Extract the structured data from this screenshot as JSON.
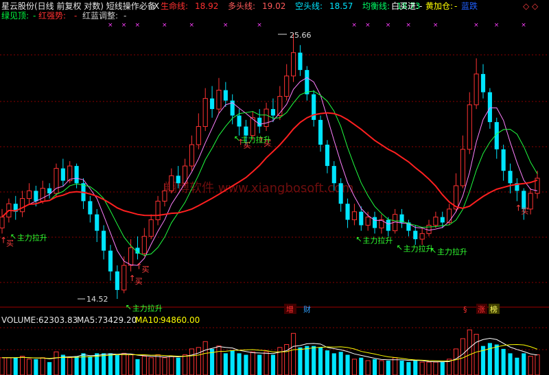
{
  "header": {
    "title": "星云股份(日线 前复权 对数) 短线操作必备",
    "close_symbol": "X",
    "indicators": [
      {
        "label": "生命线:",
        "value": "18.92",
        "color": "#ff3030"
      },
      {
        "label": "多头线:",
        "value": "19.02",
        "color": "#ff5a5a"
      },
      {
        "label": "空头线:",
        "value": "18.57",
        "color": "#00e5ff"
      },
      {
        "label": "均衡线:",
        "value": "18.73",
        "color": "#00ff66"
      }
    ],
    "buy_label": "白买进:",
    "buy_value": "-",
    "add_label": "黄加仓:",
    "add_value": "-",
    "extra_label": "蓝跌",
    "right_marker": "◇ ◇"
  },
  "subheader": {
    "green_label": "绿见顶:",
    "green_value": "-",
    "red_label": "红强势:",
    "red_value": "-",
    "adjust_label": "红蓝调整:",
    "adjust_value": "-"
  },
  "watermark": "翔博软件 www.xiangbosoft.com",
  "price_annotations": {
    "high": "25.66",
    "low": "14.52"
  },
  "signals": {
    "buy": "买",
    "pull": "主力拉升",
    "up_arrow": "↑",
    "diag_arrow": "↖"
  },
  "badges": [
    "增",
    "财",
    "§",
    "涨",
    "榜"
  ],
  "volume_header": {
    "volume_label": "VOLUME:",
    "volume_value": "62303.83",
    "ma5_label": "MA5:",
    "ma5_value": "73429.20",
    "ma10_label": "MA10:",
    "ma10_value": "94860.00"
  },
  "colors": {
    "up": "#ff3232",
    "down": "#00e5ff",
    "lifeline": "#ff2020",
    "ma_green": "#20ff40",
    "ma_pink": "#ff80ff",
    "buy_signal": "#ff4040",
    "pull_signal": "#30ff30"
  },
  "chart_data": {
    "type": "candlestick",
    "title": "星云股份(日线 前复权 对数)",
    "scale": "log",
    "ylim": [
      14.52,
      25.66
    ],
    "grid": true,
    "candles": [
      [
        16.9,
        17.3,
        17.6,
        16.7
      ],
      [
        17.3,
        17.8,
        18.0,
        17.1
      ],
      [
        17.8,
        17.5,
        18.1,
        17.2
      ],
      [
        17.5,
        18.0,
        18.3,
        17.3
      ],
      [
        18.0,
        18.3,
        18.6,
        17.8
      ],
      [
        18.3,
        17.9,
        18.5,
        17.7
      ],
      [
        17.9,
        18.4,
        18.7,
        17.8
      ],
      [
        18.4,
        18.2,
        18.6,
        18.0
      ],
      [
        18.2,
        19.2,
        19.4,
        18.1
      ],
      [
        19.2,
        18.7,
        19.6,
        18.5
      ],
      [
        18.7,
        19.3,
        19.5,
        18.6
      ],
      [
        19.3,
        18.6,
        19.4,
        18.4
      ],
      [
        18.6,
        17.9,
        18.8,
        17.6
      ],
      [
        17.9,
        17.4,
        18.1,
        17.1
      ],
      [
        17.4,
        16.8,
        17.6,
        16.4
      ],
      [
        16.8,
        16.1,
        17.0,
        15.8
      ],
      [
        16.1,
        15.4,
        16.3,
        15.1
      ],
      [
        15.4,
        14.8,
        15.6,
        14.52
      ],
      [
        14.8,
        15.6,
        15.9,
        14.7
      ],
      [
        15.6,
        16.2,
        16.5,
        15.4
      ],
      [
        16.2,
        16.0,
        16.6,
        15.8
      ],
      [
        16.0,
        16.6,
        16.9,
        15.9
      ],
      [
        16.6,
        17.2,
        17.4,
        16.5
      ],
      [
        17.2,
        17.9,
        18.1,
        17.0
      ],
      [
        17.9,
        18.3,
        18.6,
        17.7
      ],
      [
        18.3,
        18.9,
        19.2,
        18.2
      ],
      [
        18.9,
        18.6,
        19.3,
        18.4
      ],
      [
        18.6,
        19.3,
        19.6,
        18.5
      ],
      [
        19.3,
        20.2,
        20.6,
        19.1
      ],
      [
        20.2,
        21.0,
        21.6,
        20.0
      ],
      [
        21.0,
        22.3,
        22.8,
        20.8
      ],
      [
        22.3,
        21.8,
        22.9,
        21.4
      ],
      [
        21.8,
        22.7,
        23.3,
        21.6
      ],
      [
        22.7,
        22.2,
        23.1,
        21.9
      ],
      [
        22.2,
        21.5,
        22.5,
        21.1
      ],
      [
        21.5,
        21.0,
        21.8,
        20.6
      ],
      [
        21.0,
        20.6,
        21.3,
        20.2
      ],
      [
        20.6,
        21.4,
        21.7,
        20.4
      ],
      [
        21.4,
        21.0,
        21.8,
        20.7
      ],
      [
        21.0,
        21.8,
        22.1,
        20.8
      ],
      [
        21.8,
        21.5,
        22.3,
        21.2
      ],
      [
        21.5,
        22.4,
        22.9,
        21.3
      ],
      [
        22.4,
        23.4,
        24.0,
        22.2
      ],
      [
        23.4,
        24.6,
        25.66,
        23.1
      ],
      [
        24.6,
        23.7,
        25.0,
        23.4
      ],
      [
        23.7,
        22.5,
        23.9,
        22.2
      ],
      [
        22.5,
        21.3,
        22.7,
        21.0
      ],
      [
        21.3,
        20.2,
        21.5,
        19.9
      ],
      [
        20.2,
        19.3,
        20.4,
        19.0
      ],
      [
        19.3,
        18.6,
        19.5,
        18.3
      ],
      [
        18.6,
        17.8,
        18.8,
        17.5
      ],
      [
        17.8,
        17.2,
        18.0,
        16.9
      ],
      [
        17.2,
        17.5,
        17.8,
        17.0
      ],
      [
        17.5,
        17.0,
        17.7,
        16.8
      ],
      [
        17.0,
        17.3,
        17.5,
        16.8
      ],
      [
        17.3,
        16.9,
        17.5,
        16.7
      ],
      [
        16.9,
        17.2,
        17.4,
        16.7
      ],
      [
        17.2,
        16.8,
        17.3,
        16.6
      ],
      [
        16.8,
        17.4,
        17.6,
        16.7
      ],
      [
        17.4,
        17.1,
        17.6,
        16.9
      ],
      [
        17.1,
        16.8,
        17.2,
        16.6
      ],
      [
        16.8,
        16.5,
        17.0,
        16.3
      ],
      [
        16.5,
        16.7,
        16.9,
        16.3
      ],
      [
        16.7,
        17.0,
        17.2,
        16.6
      ],
      [
        17.0,
        17.3,
        17.5,
        16.9
      ],
      [
        17.3,
        17.1,
        17.5,
        16.9
      ],
      [
        17.1,
        17.6,
        17.8,
        17.0
      ],
      [
        17.6,
        18.5,
        19.0,
        17.5
      ],
      [
        18.5,
        20.0,
        20.6,
        18.4
      ],
      [
        20.0,
        22.0,
        22.6,
        19.8
      ],
      [
        22.0,
        23.5,
        24.3,
        21.8
      ],
      [
        23.5,
        22.6,
        24.0,
        22.3
      ],
      [
        22.6,
        21.2,
        22.8,
        20.9
      ],
      [
        21.2,
        20.0,
        21.4,
        19.6
      ],
      [
        20.0,
        19.1,
        20.2,
        18.7
      ],
      [
        19.1,
        18.6,
        19.4,
        18.2
      ],
      [
        18.6,
        18.3,
        18.8,
        17.9
      ],
      [
        18.3,
        17.6,
        18.4,
        17.2
      ],
      [
        17.6,
        18.2,
        18.4,
        17.4
      ],
      [
        18.2,
        18.8,
        19.1,
        18.0
      ]
    ],
    "volume_ma5": 73429.2,
    "volume_ma10": 94860.0,
    "last_volume": 62303.83
  }
}
